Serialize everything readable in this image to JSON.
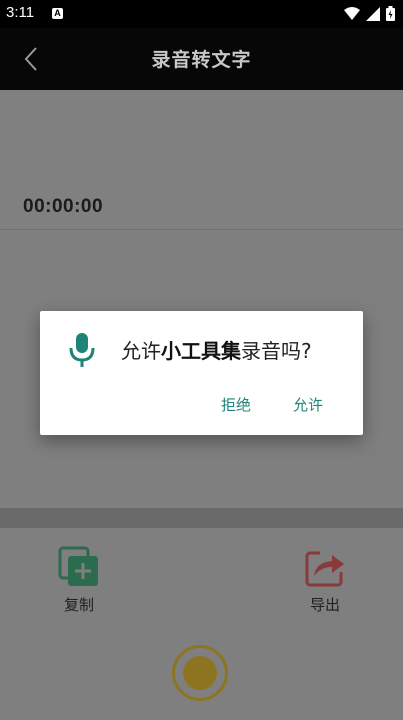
{
  "status_bar": {
    "time": "3:11",
    "notification_letter": "A"
  },
  "app_bar": {
    "title": "录音转文字"
  },
  "recorder": {
    "elapsed": "00:00:00"
  },
  "toolbar": {
    "copy_label": "复制",
    "export_label": "导出"
  },
  "permission_dialog": {
    "message_prefix": "允许",
    "app_name": "小工具集",
    "message_suffix": "录音吗?",
    "deny_label": "拒绝",
    "allow_label": "允许"
  },
  "colors": {
    "accent_teal": "#1f8377",
    "copy_icon": "#2d6b4e",
    "export_icon": "#8a3a3a",
    "record": "#8c7421"
  },
  "icons": [
    "back-icon",
    "microphone-icon",
    "copy-icon",
    "export-icon",
    "record-icon",
    "wifi-icon",
    "signal-icon",
    "battery-icon"
  ]
}
